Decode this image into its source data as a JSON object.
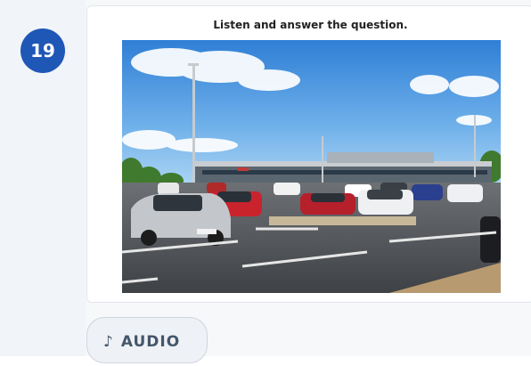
{
  "question": {
    "number": "19"
  },
  "card": {
    "instruction": "Listen and answer the question."
  },
  "audio_button": {
    "icon": "music-note-icon",
    "glyph": "♪",
    "label": "AUDIO"
  },
  "colors": {
    "badge": "#1f57b7",
    "rail": "#f1f4f8",
    "button_text": "#45566b"
  }
}
